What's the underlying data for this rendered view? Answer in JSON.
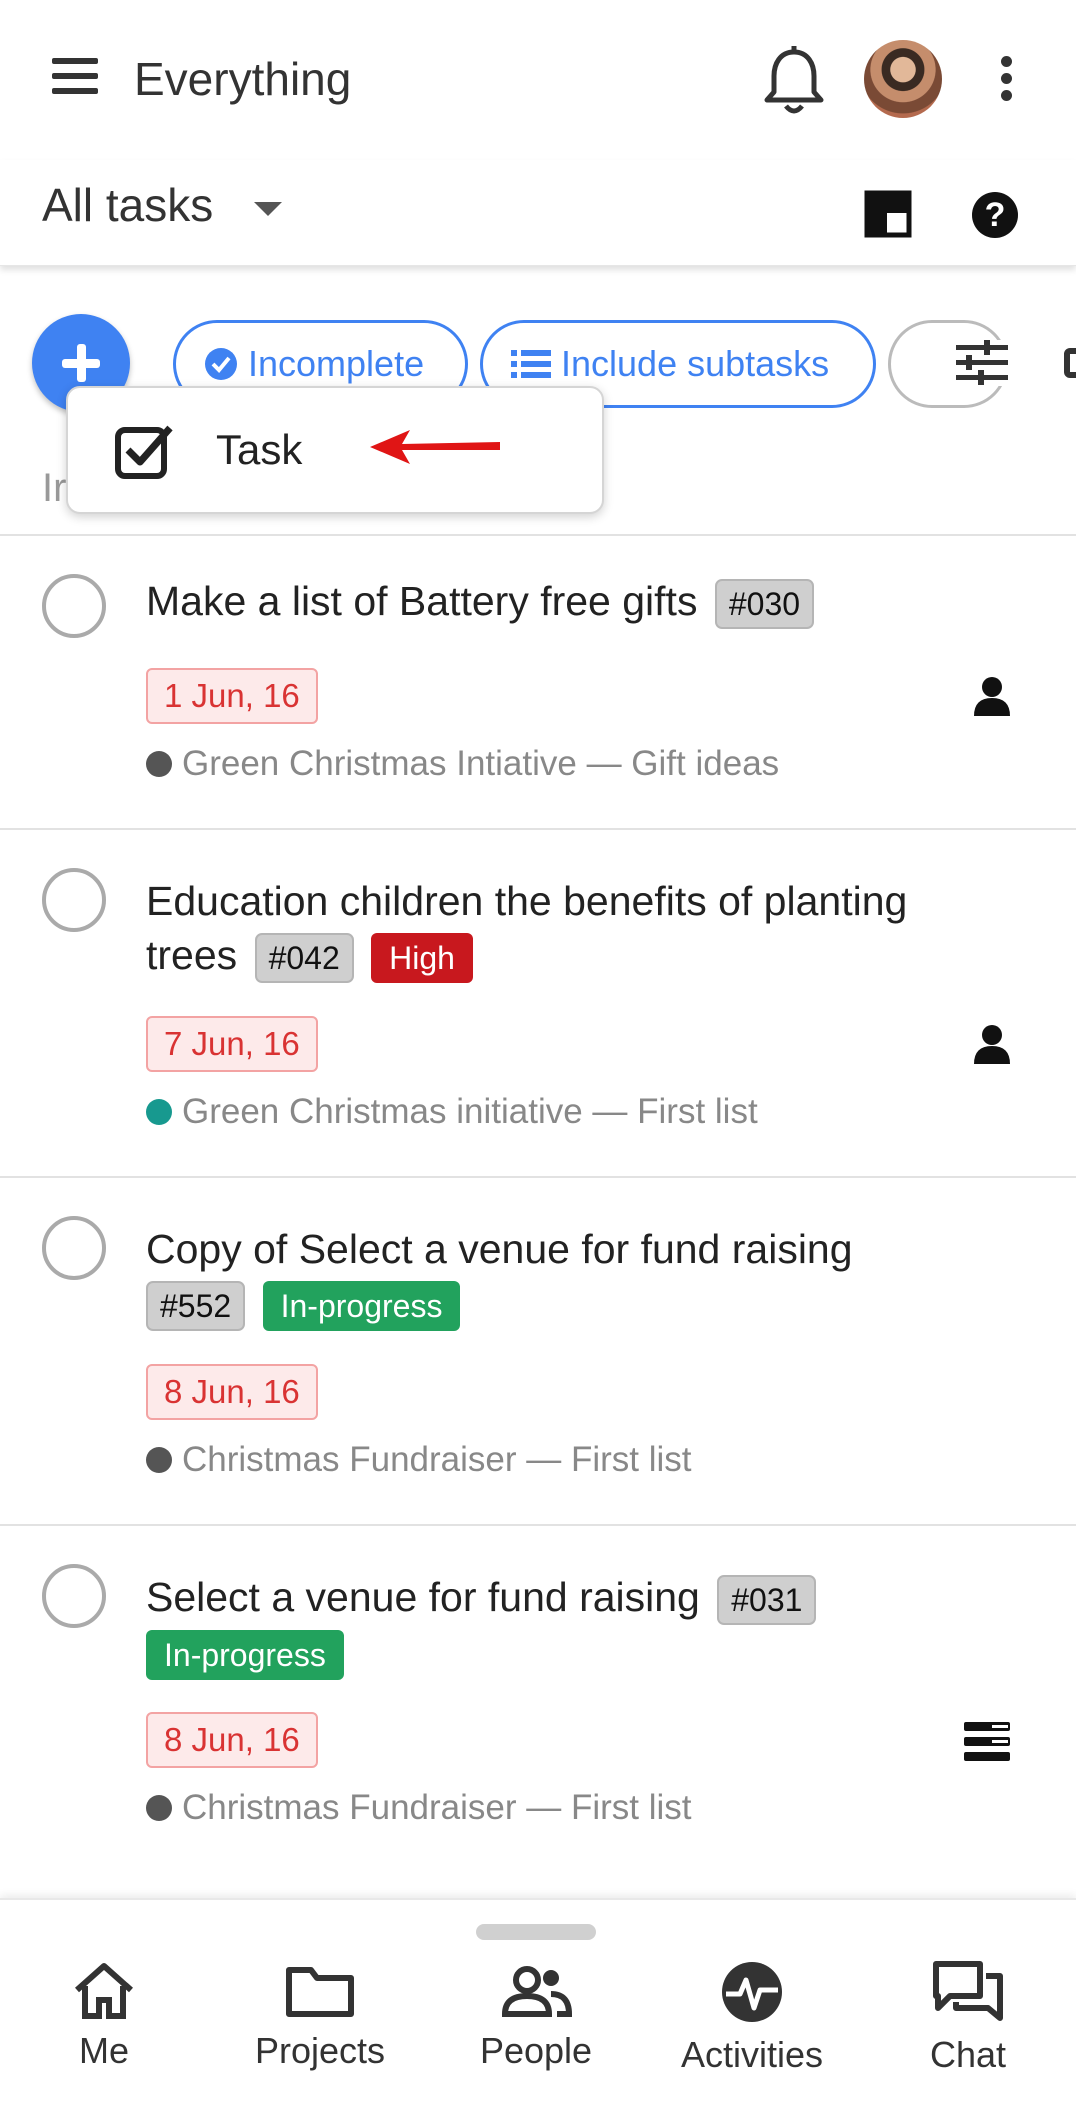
{
  "header": {
    "title": "Everything"
  },
  "view": {
    "title": "All tasks"
  },
  "filters": {
    "incomplete_label": "Incomplete",
    "subtasks_label": "Include subtasks"
  },
  "add_menu": {
    "task_label": "Task"
  },
  "list_header_partial": "Ir",
  "colors": {
    "accent": "#3f82f2",
    "danger": "#c8181e",
    "success": "#22a25d",
    "teal_dot": "#17998f"
  },
  "tasks": [
    {
      "title": "Make a list of Battery free gifts",
      "id": "#030",
      "date": "1 Jun, 16",
      "project": "Green Christmas Intiative — Gift ideas",
      "assignee_icon": "person-icon"
    },
    {
      "title": "Education children the benefits of planting trees",
      "id": "#042",
      "badge": "High",
      "date": "7 Jun, 16",
      "project": "Green Christmas initiative — First list",
      "assignee_icon": "person-icon"
    },
    {
      "title": "Copy of Select a venue for fund raising",
      "id": "#552",
      "badge": "In-progress",
      "date": "8 Jun, 16",
      "project": "Christmas Fundraiser — First list"
    },
    {
      "title": "Select a venue for fund raising",
      "id": "#031",
      "badge": "In-progress",
      "date": "8 Jun, 16",
      "project": "Christmas Fundraiser — First list",
      "assignee_icon": "list-icon"
    }
  ],
  "nav": [
    {
      "label": "Me",
      "icon": "home-icon"
    },
    {
      "label": "Projects",
      "icon": "folder-icon"
    },
    {
      "label": "People",
      "icon": "people-icon"
    },
    {
      "label": "Activities",
      "icon": "activity-icon"
    },
    {
      "label": "Chat",
      "icon": "chat-icon"
    }
  ]
}
